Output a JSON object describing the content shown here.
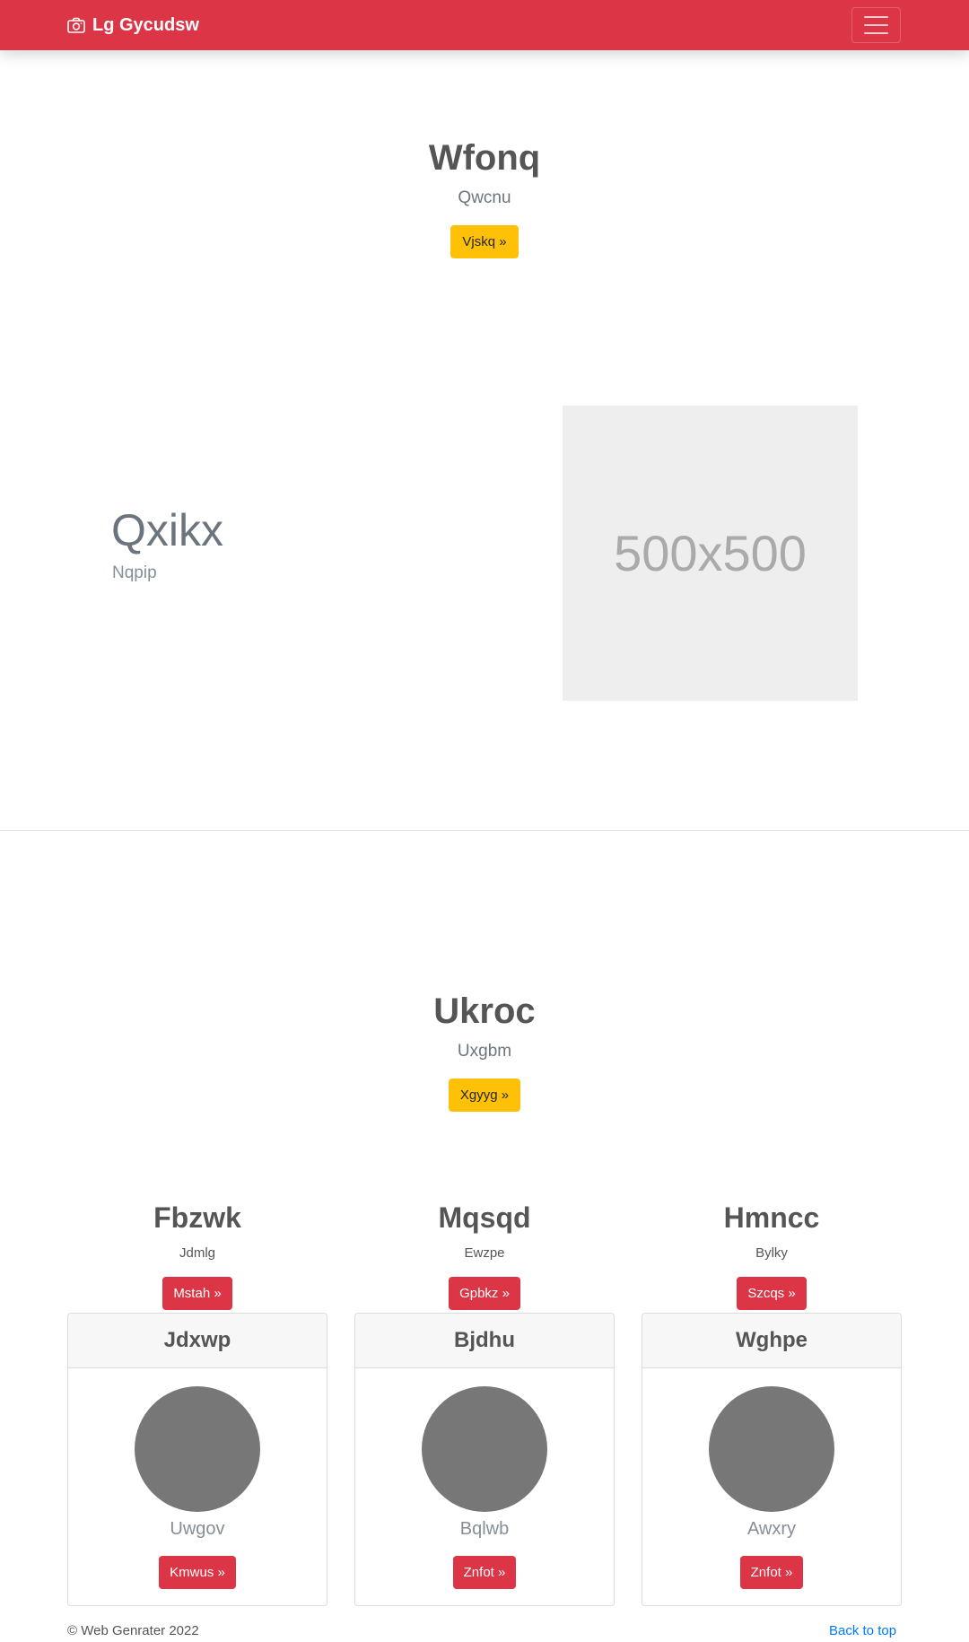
{
  "navbar": {
    "brand": "Lg Gycudsw",
    "brand_icon": "camera-icon",
    "toggler_icon": "hamburger-icon",
    "color": "#dc3545"
  },
  "hero1": {
    "title": "Wfonq",
    "subtitle": "Qwcnu",
    "button": "Vjskq »"
  },
  "feature": {
    "title": "Qxikx",
    "subtitle": "Nqpip",
    "image_label": "500x500"
  },
  "hero2": {
    "title": "Ukroc",
    "subtitle": "Uxgbm",
    "button": "Xgyyg »"
  },
  "columns": [
    {
      "title": "Fbzwk",
      "text": "Jdmlg",
      "button": "Mstah »"
    },
    {
      "title": "Mqsqd",
      "text": "Ewzpe",
      "button": "Gpbkz »"
    },
    {
      "title": "Hmncc",
      "text": "Bylky",
      "button": "Szcqs »"
    }
  ],
  "cards": [
    {
      "header": "Jdxwp",
      "name": "Uwgov",
      "button": "Kmwus »"
    },
    {
      "header": "Bjdhu",
      "name": "Bqlwb",
      "button": "Znfot »"
    },
    {
      "header": "Wghpe",
      "name": "Awxry",
      "button": "Znfot »"
    }
  ],
  "footer": {
    "copyright": "© Web Genrater 2022",
    "back_to_top": "Back to top"
  }
}
